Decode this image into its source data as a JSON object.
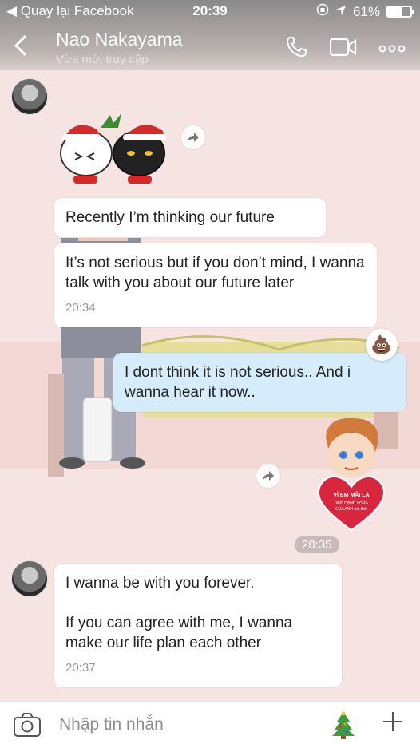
{
  "status_bar": {
    "back_app": "◀ Quay lại Facebook",
    "time": "20:39",
    "battery": "61%"
  },
  "header": {
    "name": "Nao Nakayama",
    "subtitle": "Vừa mới truy cập"
  },
  "messages": {
    "m1": "Recently I’m thinking our future",
    "m2": "It’s not serious but if you don’t mind, I wanna talk with you about our future later",
    "m2_time": "20:34",
    "m3": "I dont think it is not serious.. And i wanna hear it now..",
    "m3_reaction": "💩",
    "time_chip": "20:35",
    "m4_line1": "I wanna be with you forever.",
    "m4_line2": "If you can agree with me, I wanna make our life plan each other",
    "m4_time": "20:37"
  },
  "sticker_heart": {
    "line1": "VÌ EM MÃI LÀ",
    "line2": "niềm HẠNH PHÚC",
    "line3": "CỦA ANH mà thôi"
  },
  "input": {
    "placeholder": "Nhập tin nhắn"
  },
  "icons": {
    "back": "chevron-left-icon",
    "call": "phone-icon",
    "video": "video-camera-icon",
    "more": "more-dots-icon",
    "camera": "camera-icon",
    "tree": "christmas-tree-icon",
    "plus": "plus-icon",
    "forward": "share-forward-icon"
  },
  "colors": {
    "chat_bg": "#f6e4e2",
    "sent_bubble": "#d6ecfb",
    "received_bubble": "#ffffff"
  }
}
